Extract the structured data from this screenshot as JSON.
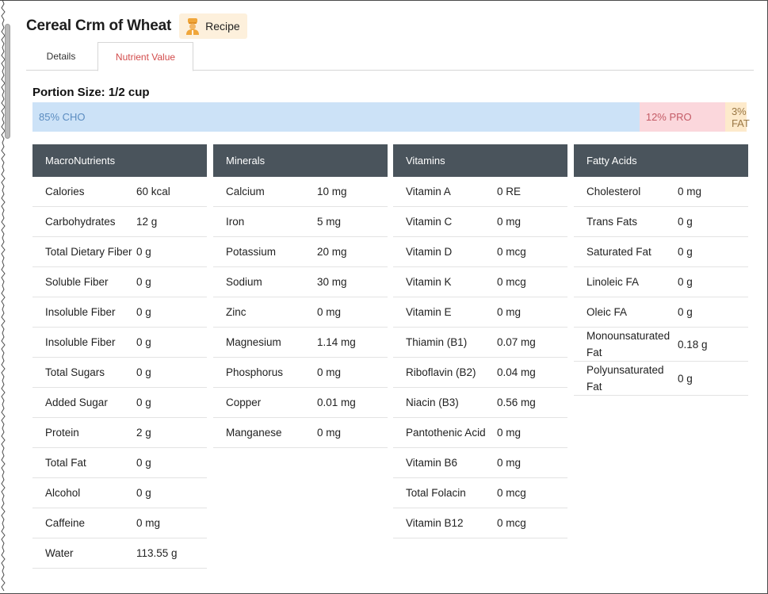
{
  "header": {
    "title": "Cereal Crm of Wheat",
    "badge_label": "Recipe",
    "badge_icon": "chef-icon"
  },
  "tabs": [
    {
      "label": "Details",
      "active": false
    },
    {
      "label": "Nutrient Value",
      "active": true
    }
  ],
  "portion": {
    "text": "Portion Size: 1/2 cup"
  },
  "macro_split": [
    {
      "label": "85% CHO",
      "percent": 85,
      "color": "#cce2f7"
    },
    {
      "label": "12% PRO",
      "percent": 12,
      "color": "#fbd7dc"
    },
    {
      "label": "3% FAT",
      "percent": 3,
      "color": "#fdeacb"
    }
  ],
  "tables": [
    {
      "title": "MacroNutrients",
      "rows": [
        {
          "label": "Calories",
          "value": "60 kcal"
        },
        {
          "label": "Carbohydrates",
          "value": "12 g"
        },
        {
          "label": "Total Dietary Fiber",
          "value": "0 g"
        },
        {
          "label": "Soluble Fiber",
          "value": "0 g"
        },
        {
          "label": "Insoluble Fiber",
          "value": "0 g"
        },
        {
          "label": "Insoluble Fiber",
          "value": "0 g"
        },
        {
          "label": "Total Sugars",
          "value": "0 g"
        },
        {
          "label": "Added Sugar",
          "value": "0 g"
        },
        {
          "label": "Protein",
          "value": "2 g"
        },
        {
          "label": "Total Fat",
          "value": "0 g"
        },
        {
          "label": "Alcohol",
          "value": "0 g"
        },
        {
          "label": "Caffeine",
          "value": "0 mg"
        },
        {
          "label": "Water",
          "value": "113.55 g"
        }
      ]
    },
    {
      "title": "Minerals",
      "rows": [
        {
          "label": "Calcium",
          "value": "10 mg"
        },
        {
          "label": "Iron",
          "value": "5 mg"
        },
        {
          "label": "Potassium",
          "value": "20 mg"
        },
        {
          "label": "Sodium",
          "value": "30 mg"
        },
        {
          "label": "Zinc",
          "value": "0 mg"
        },
        {
          "label": "Magnesium",
          "value": "1.14 mg"
        },
        {
          "label": "Phosphorus",
          "value": "0 mg"
        },
        {
          "label": "Copper",
          "value": "0.01 mg"
        },
        {
          "label": "Manganese",
          "value": "0 mg"
        }
      ]
    },
    {
      "title": "Vitamins",
      "rows": [
        {
          "label": "Vitamin A",
          "value": "0 RE"
        },
        {
          "label": "Vitamin C",
          "value": "0 mg"
        },
        {
          "label": "Vitamin D",
          "value": "0 mcg"
        },
        {
          "label": "Vitamin K",
          "value": "0 mcg"
        },
        {
          "label": "Vitamin E",
          "value": "0 mg"
        },
        {
          "label": "Thiamin (B1)",
          "value": "0.07 mg"
        },
        {
          "label": "Riboflavin (B2)",
          "value": "0.04 mg"
        },
        {
          "label": "Niacin (B3)",
          "value": "0.56 mg"
        },
        {
          "label": "Pantothenic Acid",
          "value": "0 mg"
        },
        {
          "label": "Vitamin B6",
          "value": "0 mg"
        },
        {
          "label": "Total Folacin",
          "value": "0 mcg"
        },
        {
          "label": "Vitamin B12",
          "value": "0 mcg"
        }
      ]
    },
    {
      "title": "Fatty Acids",
      "rows": [
        {
          "label": "Cholesterol",
          "value": "0 mg"
        },
        {
          "label": "Trans Fats",
          "value": "0 g"
        },
        {
          "label": "Saturated Fat",
          "value": "0 g"
        },
        {
          "label": "Linoleic FA",
          "value": "0 g"
        },
        {
          "label": "Oleic FA",
          "value": "0 g"
        },
        {
          "label": "Monounsaturated Fat",
          "value": "0.18 g"
        },
        {
          "label": "Polyunsaturated Fat",
          "value": "0 g"
        }
      ]
    }
  ]
}
